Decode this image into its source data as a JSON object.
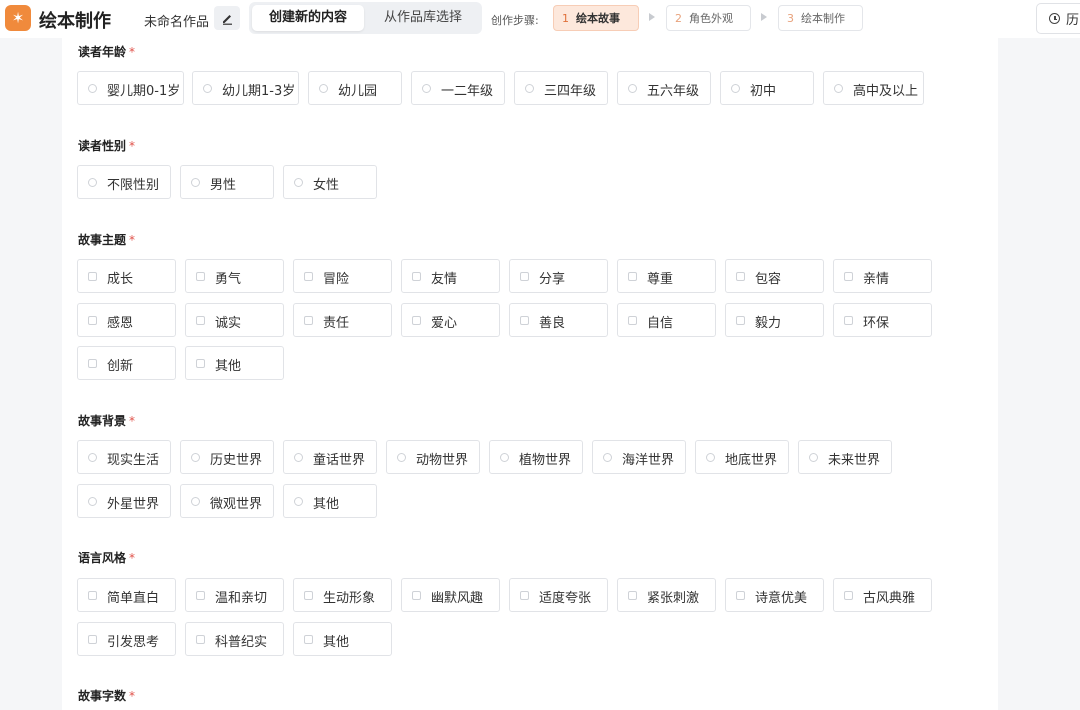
{
  "header": {
    "logo_glyph": "✶",
    "app_title": "绘本制作",
    "doc_name": "未命名作品",
    "mode_tabs": [
      "创建新的内容",
      "从作品库选择"
    ],
    "steps_label": "创作步骤:",
    "steps": [
      {
        "num": "1",
        "label": "绘本故事"
      },
      {
        "num": "2",
        "label": "角色外观"
      },
      {
        "num": "3",
        "label": "绘本制作"
      }
    ],
    "history_label": "历"
  },
  "colors": {
    "accent": "#f08a3c",
    "step_active_bg": "#fde8dc",
    "required": "#e0524a"
  },
  "form": {
    "required_mark": "*",
    "age": {
      "label": "读者年龄",
      "options": [
        "婴儿期0-1岁",
        "幼儿期1-3岁",
        "幼儿园",
        "一二年级",
        "三四年级",
        "五六年级",
        "初中",
        "高中及以上"
      ]
    },
    "gender": {
      "label": "读者性别",
      "options": [
        "不限性别",
        "男性",
        "女性"
      ]
    },
    "theme": {
      "label": "故事主题",
      "options": [
        "成长",
        "勇气",
        "冒险",
        "友情",
        "分享",
        "尊重",
        "包容",
        "亲情",
        "感恩",
        "诚实",
        "责任",
        "爱心",
        "善良",
        "自信",
        "毅力",
        "环保",
        "创新",
        "其他"
      ]
    },
    "background": {
      "label": "故事背景",
      "options": [
        "现实生活",
        "历史世界",
        "童话世界",
        "动物世界",
        "植物世界",
        "海洋世界",
        "地底世界",
        "未来世界",
        "外星世界",
        "微观世界",
        "其他"
      ]
    },
    "style": {
      "label": "语言风格",
      "options": [
        "简单直白",
        "温和亲切",
        "生动形象",
        "幽默风趣",
        "适度夸张",
        "紧张刺激",
        "诗意优美",
        "古风典雅",
        "引发思考",
        "科普纪实",
        "其他"
      ]
    },
    "word_count": {
      "label": "故事字数"
    }
  }
}
